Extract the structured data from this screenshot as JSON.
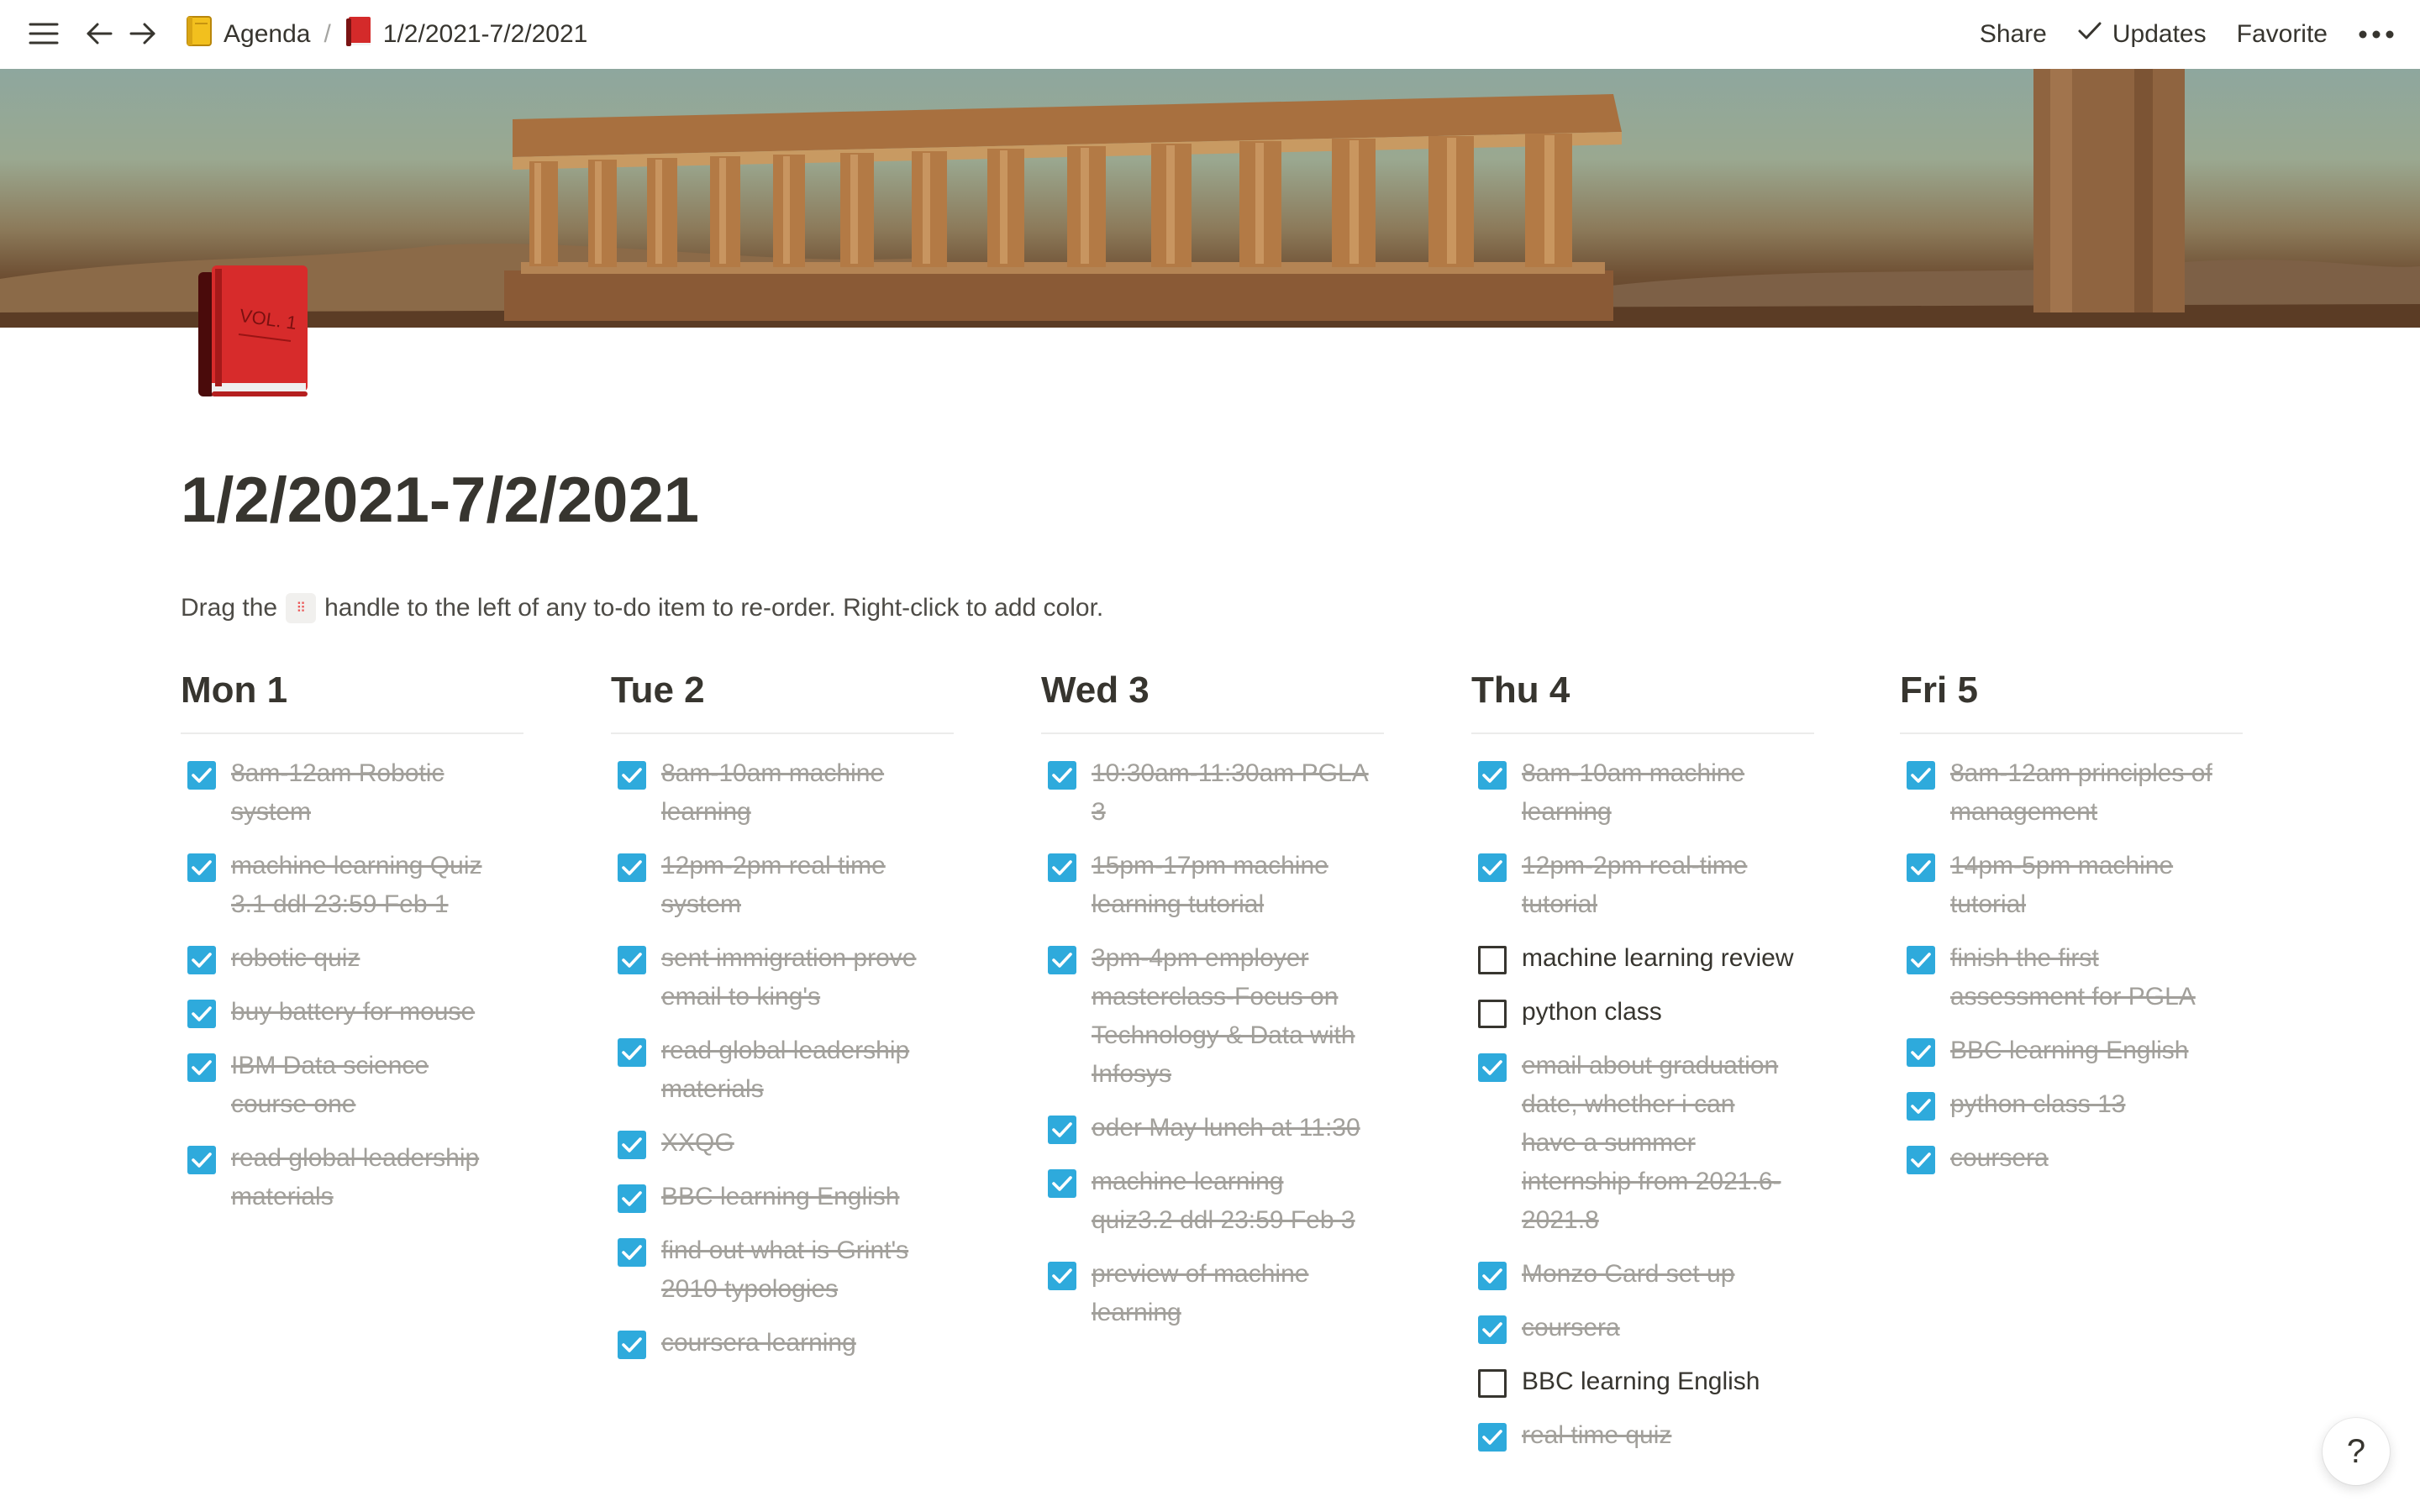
{
  "topbar": {
    "breadcrumbs": [
      {
        "label": "Agenda",
        "icon": "ledger-icon"
      },
      {
        "label": "1/2/2021-7/2/2021",
        "icon": "red-book-icon"
      }
    ],
    "separator": "/",
    "share_label": "Share",
    "updates_label": "Updates",
    "favorite_label": "Favorite"
  },
  "page": {
    "title": "1/2/2021-7/2/2021",
    "hint_before": "Drag the",
    "hint_handle": "⠿",
    "hint_after": "handle to the left of any to-do item to re-order. Right-click to add color."
  },
  "cover": {
    "description_icon": "parthenon-painting"
  },
  "page_icon": {
    "name": "red-book-icon",
    "text": "VOL. 1"
  },
  "columns": [
    {
      "day": "Mon 1",
      "todos": [
        {
          "checked": true,
          "lines": [
            "8am-12am Robotic",
            "system"
          ]
        },
        {
          "checked": true,
          "lines": [
            "machine learning Quiz",
            "3.1 ddl 23:59 Feb 1"
          ]
        },
        {
          "checked": true,
          "lines": [
            "robotic quiz"
          ]
        },
        {
          "checked": true,
          "lines": [
            "buy battery for mouse"
          ]
        },
        {
          "checked": true,
          "lines": [
            "IBM Data science",
            "course one"
          ]
        },
        {
          "checked": true,
          "lines": [
            "read global leadership",
            "materials"
          ]
        }
      ]
    },
    {
      "day": "Tue 2",
      "todos": [
        {
          "checked": true,
          "lines": [
            "8am-10am machine",
            "learning"
          ]
        },
        {
          "checked": true,
          "lines": [
            "12pm-2pm real time",
            "system"
          ]
        },
        {
          "checked": true,
          "lines": [
            "sent immigration prove",
            "email to king's"
          ]
        },
        {
          "checked": true,
          "lines": [
            "read global leadership",
            "materials"
          ]
        },
        {
          "checked": true,
          "lines": [
            "XXQG"
          ]
        },
        {
          "checked": true,
          "lines": [
            "BBC learning English"
          ]
        },
        {
          "checked": true,
          "lines": [
            "find out what is Grint's",
            "2010 typologies"
          ]
        },
        {
          "checked": true,
          "lines": [
            "coursera learning"
          ]
        }
      ]
    },
    {
      "day": "Wed 3",
      "todos": [
        {
          "checked": true,
          "lines": [
            "10:30am-11:30am PGLA",
            "3"
          ]
        },
        {
          "checked": true,
          "lines": [
            "15pm-17pm machine",
            "learning tutorial"
          ]
        },
        {
          "checked": true,
          "lines": [
            "3pm-4pm employer",
            "masterclass-Focus on",
            "Technology & Data with",
            "Infosys"
          ]
        },
        {
          "checked": true,
          "lines": [
            "oder May lunch at 11:30"
          ]
        },
        {
          "checked": true,
          "lines": [
            "machine learning",
            "quiz3.2 ddl 23:59 Feb 3"
          ]
        },
        {
          "checked": true,
          "lines": [
            "preview of machine",
            "learning"
          ]
        }
      ]
    },
    {
      "day": "Thu 4",
      "todos": [
        {
          "checked": true,
          "lines": [
            "8am-10am machine",
            "learning"
          ]
        },
        {
          "checked": true,
          "lines": [
            "12pm-2pm real-time",
            "tutorial"
          ]
        },
        {
          "checked": false,
          "lines": [
            "machine learning review"
          ]
        },
        {
          "checked": false,
          "lines": [
            "python class"
          ]
        },
        {
          "checked": true,
          "lines": [
            "email about graduation",
            "date, whether i can",
            "have a summer",
            "internship from 2021.6-",
            "2021.8"
          ]
        },
        {
          "checked": true,
          "lines": [
            "Monzo Card set up"
          ]
        },
        {
          "checked": true,
          "lines": [
            "coursera"
          ]
        },
        {
          "checked": false,
          "lines": [
            "BBC learning English"
          ]
        },
        {
          "checked": true,
          "lines": [
            "real time quiz"
          ]
        }
      ]
    },
    {
      "day": "Fri 5",
      "todos": [
        {
          "checked": true,
          "lines": [
            "8am-12am principles of",
            "management"
          ]
        },
        {
          "checked": true,
          "lines": [
            "14pm-5pm machine",
            "tutorial"
          ]
        },
        {
          "checked": true,
          "lines": [
            "finish the first",
            "assessment for PGLA"
          ]
        },
        {
          "checked": true,
          "lines": [
            "BBC learning English"
          ]
        },
        {
          "checked": true,
          "lines": [
            "python class 13"
          ]
        },
        {
          "checked": true,
          "lines": [
            "coursera"
          ]
        }
      ]
    }
  ],
  "help_label": "?",
  "colors": {
    "checkbox_checked": "#2eaadc",
    "done_text": "#a2a09b",
    "text": "#37352f"
  }
}
